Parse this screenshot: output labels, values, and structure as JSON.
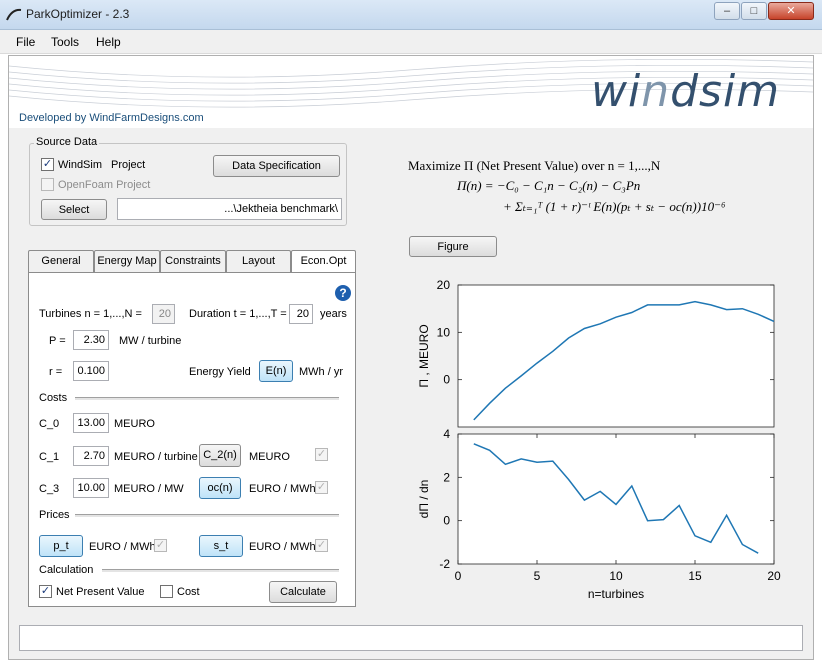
{
  "window": {
    "title": "ParkOptimizer - 2.3",
    "minimize": "–",
    "maximize": "□",
    "close": "✕"
  },
  "menu": [
    "File",
    "Tools",
    "Help"
  ],
  "branding": {
    "developer": "Developed by WindFarmDesigns.com",
    "logo_left": "wi",
    "logo_n": "n",
    "logo_right": "dsim"
  },
  "source": {
    "legend": "Source Data",
    "windsim_label": "WindSim",
    "windsim_checked": true,
    "project_label": "Project",
    "openfoam_label": "OpenFoam Project",
    "openfoam_checked": false,
    "data_spec_button": "Data Specification",
    "select_button": "Select",
    "path_value": "...\\Jektheia benchmark\\"
  },
  "tabs": [
    "General",
    "Energy Map",
    "Constraints",
    "Layout",
    "Econ.Opt"
  ],
  "panel": {
    "help": "?",
    "turbines_label": "Turbines  n = 1,...,N =",
    "N_value": "20",
    "duration_label": "Duration  t = 1,...,T =",
    "T_value": "20",
    "years": "years",
    "P_label": "P =",
    "P_value": "2.30",
    "P_unit": "MW / turbine",
    "r_label": "r =",
    "r_value": "0.100",
    "energy_yield_label": "Energy Yield",
    "En_button": "E(n)",
    "En_unit": "MWh / yr",
    "costs_label": "Costs",
    "C0_label": "C_0",
    "C0_value": "13.00",
    "C0_unit": "MEURO",
    "C1_label": "C_1",
    "C1_value": "2.70",
    "C1_unit": "MEURO / turbine",
    "C2_button": "C_2(n)",
    "C2_unit": "MEURO",
    "C3_label": "C_3",
    "C3_value": "10.00",
    "C3_unit": "MEURO / MW",
    "oc_button": "oc(n)",
    "oc_unit": "EURO / MWh",
    "prices_label": "Prices",
    "pt_button": "p_t",
    "pt_unit": "EURO / MWh",
    "st_button": "s_t",
    "st_unit": "EURO / MWh",
    "calculation_label": "Calculation",
    "npv_label": "Net Present Value",
    "npv_checked": true,
    "cost_label": "Cost",
    "cost_checked": false,
    "calculate_button": "Calculate"
  },
  "formula": {
    "line1": "Maximize Π (Net Present Value) over n = 1,...,N",
    "line2": "Π(n) = −C₀ − C₁n − C₂(n) − C₃Pn",
    "line3": "+ Σₜ₌₁ᵀ (1 + r)⁻ᵗ E(n)(pₜ + sₜ − oc(n))10⁻⁶"
  },
  "figure_button": "Figure",
  "chart_data": [
    {
      "type": "line",
      "ylabel": "Π ,  MEURO",
      "xlim": [
        0,
        20
      ],
      "ylim": [
        -10,
        20
      ],
      "yticks": [
        20,
        10,
        0
      ],
      "x": [
        1,
        2,
        3,
        4,
        5,
        6,
        7,
        8,
        9,
        10,
        11,
        12,
        13,
        14,
        15,
        16,
        17,
        18,
        19,
        20
      ],
      "y": [
        -8.5,
        -5,
        -1.8,
        0.8,
        3.5,
        6,
        8.8,
        10.8,
        11.8,
        13.2,
        14.2,
        15.8,
        15.8,
        15.8,
        16.5,
        15.8,
        14.8,
        15.0,
        13.8,
        12.3
      ],
      "color": "#1f77b4"
    },
    {
      "type": "line",
      "ylabel": "dΠ / dn",
      "xlabel": "n=turbines",
      "xlim": [
        0,
        20
      ],
      "ylim": [
        -2,
        4
      ],
      "xticks": [
        0,
        5,
        10,
        15,
        20
      ],
      "yticks": [
        4,
        2,
        0,
        -2
      ],
      "x": [
        1,
        2,
        3,
        4,
        5,
        6,
        7,
        8,
        9,
        10,
        11,
        12,
        13,
        14,
        15,
        16,
        17,
        18,
        19
      ],
      "y": [
        3.55,
        3.25,
        2.6,
        2.85,
        2.7,
        2.75,
        1.9,
        0.95,
        1.35,
        0.75,
        1.6,
        0.0,
        0.05,
        0.7,
        -0.7,
        -1.0,
        0.25,
        -1.1,
        -1.5
      ],
      "color": "#1f77b4"
    }
  ]
}
